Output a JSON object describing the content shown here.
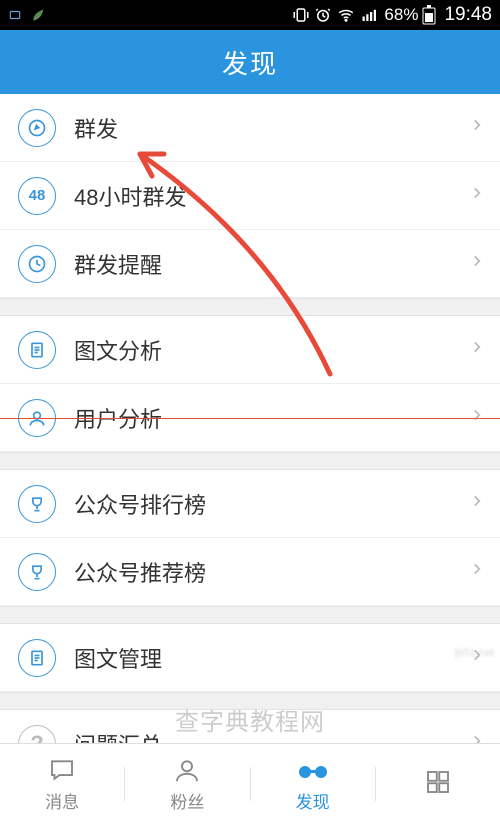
{
  "status": {
    "battery_pct": "68%",
    "time": "19:48"
  },
  "header": {
    "title": "发现"
  },
  "groups": [
    {
      "items": [
        {
          "icon": "compose",
          "label": "群发"
        },
        {
          "icon": "48",
          "label": "48小时群发"
        },
        {
          "icon": "clock",
          "label": "群发提醒"
        }
      ]
    },
    {
      "items": [
        {
          "icon": "doc",
          "label": "图文分析"
        },
        {
          "icon": "user",
          "label": "用户分析"
        }
      ]
    },
    {
      "items": [
        {
          "icon": "trophy",
          "label": "公众号排行榜"
        },
        {
          "icon": "trophy",
          "label": "公众号推荐榜"
        }
      ]
    },
    {
      "items": [
        {
          "icon": "doc",
          "label": "图文管理"
        }
      ]
    },
    {
      "items": [
        {
          "icon": "q",
          "label": "问题汇总"
        }
      ]
    }
  ],
  "nav": {
    "items": [
      {
        "label": "消息",
        "active": false
      },
      {
        "label": "粉丝",
        "active": false
      },
      {
        "label": "发现",
        "active": true
      },
      {
        "label": "",
        "active": false
      }
    ]
  },
  "watermark": {
    "text": "查字典教程网",
    "corner": "jb51.net"
  },
  "annotation": {
    "target_label": "群发"
  }
}
